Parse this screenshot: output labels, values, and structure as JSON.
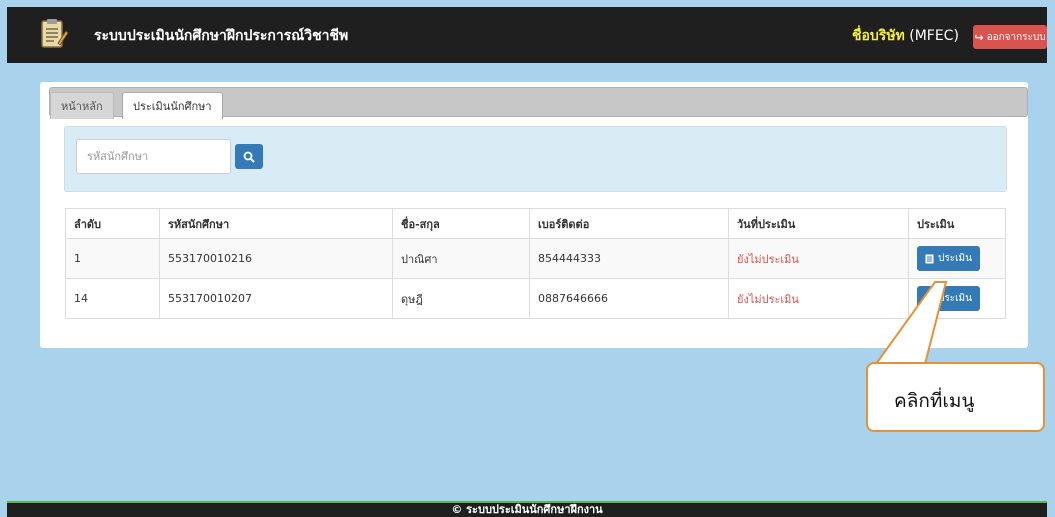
{
  "header": {
    "title": "ระบบประเมินนักศึกษาฝึกประการณ์วิชาชีพ",
    "company_name": "ชื่อบริษัท",
    "company_code": "(MFEC)",
    "logout_label": "ออกจากระบบ"
  },
  "tabs": [
    {
      "label": "หน้าหลัก"
    },
    {
      "label": "ประเมินนักศึกษา"
    }
  ],
  "search": {
    "placeholder": "รหัสนักศึกษา",
    "value": ""
  },
  "table": {
    "headers": [
      "ลำดับ",
      "รหัสนักศึกษา",
      "ชื่อ-สกุล",
      "เบอร์ติดต่อ",
      "วันที่ประเมิน",
      "ประเมิน"
    ],
    "rows": [
      {
        "no": "1",
        "student_id": "553170010216",
        "name": "ปาณิศา",
        "phone": "854444333",
        "status": "ยังไม่ประเมิน",
        "action": "ประเมิน"
      },
      {
        "no": "14",
        "student_id": "553170010207",
        "name": "ดุษฎี",
        "phone": "0887646666",
        "status": "ยังไม่ประเมิน",
        "action": "ประเมิน"
      }
    ]
  },
  "footer": {
    "text": "© ระบบประเมินนักศึกษาฝึกงาน"
  },
  "callout": {
    "text": "คลิกที่เมนู"
  },
  "colors": {
    "background": "#a9d3ec",
    "topbar": "#1f1f1f",
    "primary": "#337ab7",
    "danger": "#d9534f",
    "accent_yellow": "#f2ee3a",
    "callout_border": "#e39237"
  },
  "icons": {
    "logo": "notepad-logo-icon",
    "logout": "logout-icon",
    "search": "search-icon",
    "evaluate": "document-icon"
  }
}
